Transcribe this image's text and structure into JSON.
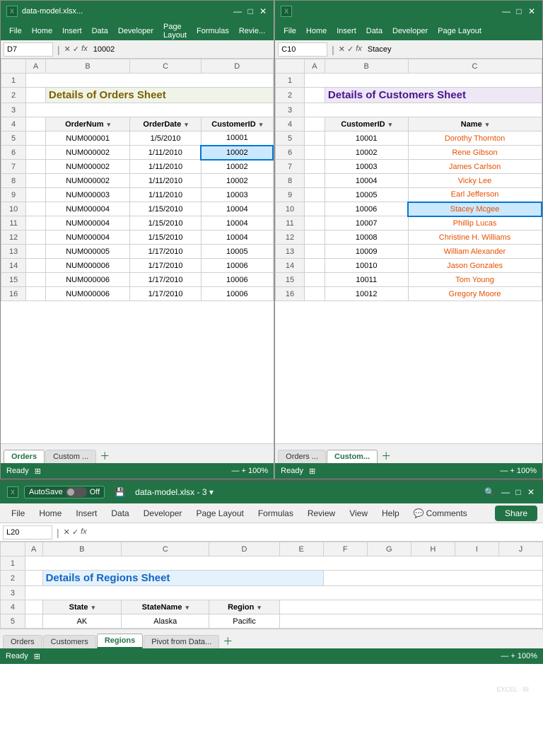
{
  "topLeft": {
    "titleBar": {
      "filename": "data-model.xlsx...",
      "controls": [
        "—",
        "□",
        "✕"
      ]
    },
    "menuBar": [
      "File",
      "Home",
      "Insert",
      "Data",
      "Developer",
      "Page Layout",
      "Formulas",
      "Revie..."
    ],
    "formulaBar": {
      "nameBox": "D7",
      "value": "10002"
    },
    "sheetTitle": "Details of Orders Sheet",
    "columns": [
      "",
      "A",
      "B",
      "C",
      "D"
    ],
    "headers": [
      "OrderNum",
      "OrderDate",
      "CustomerID"
    ],
    "rows": [
      [
        "NUM000001",
        "1/5/2010",
        "10001"
      ],
      [
        "NUM000002",
        "1/11/2010",
        "10002"
      ],
      [
        "NUM000002",
        "1/11/2010",
        "10002"
      ],
      [
        "NUM000002",
        "1/11/2010",
        "10002"
      ],
      [
        "NUM000003",
        "1/11/2010",
        "10003"
      ],
      [
        "NUM000004",
        "1/15/2010",
        "10004"
      ],
      [
        "NUM000004",
        "1/15/2010",
        "10004"
      ],
      [
        "NUM000004",
        "1/15/2010",
        "10004"
      ],
      [
        "NUM000005",
        "1/17/2010",
        "10005"
      ],
      [
        "NUM000006",
        "1/17/2010",
        "10006"
      ],
      [
        "NUM000006",
        "1/17/2010",
        "10006"
      ],
      [
        "NUM000006",
        "1/17/2010",
        "10006"
      ]
    ],
    "tabs": [
      "Orders",
      "Custom ..."
    ],
    "activeTab": "Orders",
    "status": "Ready"
  },
  "topRight": {
    "titleBar": {
      "filename": "",
      "controls": [
        "—",
        "□",
        "✕"
      ]
    },
    "menuBar": [
      "File",
      "Home",
      "Insert",
      "Data",
      "Developer",
      "Page Layout"
    ],
    "formulaBar": {
      "nameBox": "C10",
      "value": "Stacey"
    },
    "sheetTitle": "Details of Customers Sheet",
    "columns": [
      "",
      "A",
      "B",
      "C"
    ],
    "headers": [
      "CustomerID",
      "Name"
    ],
    "rows": [
      [
        "10001",
        "Dorothy Thornton"
      ],
      [
        "10002",
        "Rene Gibson"
      ],
      [
        "10003",
        "James Carlson"
      ],
      [
        "10004",
        "Vicky Lee"
      ],
      [
        "10005",
        "Earl Jefferson"
      ],
      [
        "10006",
        "Stacey Mcgee"
      ],
      [
        "10007",
        "Phillip Lucas"
      ],
      [
        "10008",
        "Christine H. Williams"
      ],
      [
        "10009",
        "William Alexander"
      ],
      [
        "10010",
        "Jason Gonzales"
      ],
      [
        "10011",
        "Tom Young"
      ],
      [
        "10012",
        "Gregory Moore"
      ]
    ],
    "tabs": [
      "Orders ...",
      "Custom..."
    ],
    "activeTab": "Custom...",
    "status": "Ready"
  },
  "bottom": {
    "titleBar": {
      "autosave": "AutoSave",
      "autosaveState": "Off",
      "filename": "data-model.xlsx - 3 ▾",
      "controls": [
        "—",
        "□",
        "✕"
      ]
    },
    "menuBar": [
      "File",
      "Home",
      "Insert",
      "Data",
      "Developer",
      "Page Layout",
      "Formulas",
      "Review",
      "View",
      "Help"
    ],
    "commentsBtn": "Comments",
    "shareBtn": "Share",
    "formulaBar": {
      "nameBox": "L20",
      "value": ""
    },
    "sheetTitle": "Details of Regions Sheet",
    "columns": [
      "",
      "A",
      "B",
      "C",
      "D",
      "E",
      "F",
      "G",
      "H",
      "I",
      "J"
    ],
    "headers": [
      "State",
      "StateName",
      "Region"
    ],
    "rows": [
      [
        "AK",
        "Alaska",
        "Pacific"
      ]
    ],
    "tabs": [
      "Orders",
      "Customers",
      "Regions",
      "Pivot from Data..."
    ],
    "activeTab": "Regions",
    "status": "Ready"
  }
}
